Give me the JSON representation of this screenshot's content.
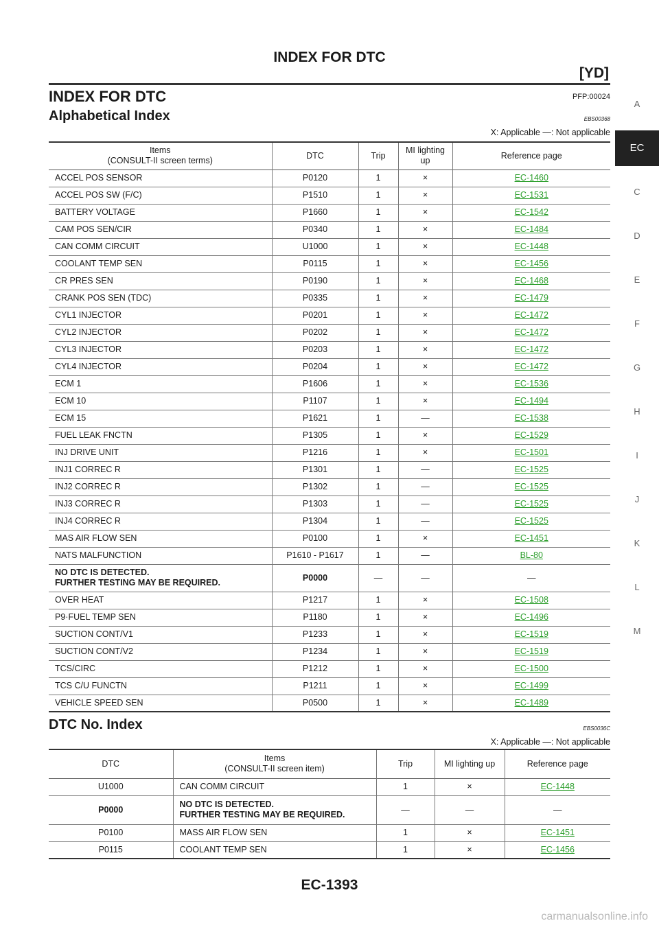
{
  "header": {
    "title": "INDEX FOR DTC",
    "variant": "[YD]"
  },
  "section": {
    "title": "INDEX FOR DTC",
    "code": "PFP:00024"
  },
  "alpha": {
    "title": "Alphabetical Index",
    "code": "EBS00368",
    "legend": "X: Applicable —: Not applicable",
    "columns": {
      "items_1": "Items",
      "items_2": "(CONSULT-II screen terms)",
      "dtc": "DTC",
      "trip": "Trip",
      "mi_1": "MI lighting",
      "mi_2": "up",
      "ref": "Reference page"
    },
    "rows": [
      {
        "item": "ACCEL POS SENSOR",
        "dtc": "P0120",
        "trip": "1",
        "mi": "×",
        "ref": "EC-1460"
      },
      {
        "item": "ACCEL POS SW (F/C)",
        "dtc": "P1510",
        "trip": "1",
        "mi": "×",
        "ref": "EC-1531"
      },
      {
        "item": "BATTERY VOLTAGE",
        "dtc": "P1660",
        "trip": "1",
        "mi": "×",
        "ref": "EC-1542"
      },
      {
        "item": "CAM POS SEN/CIR",
        "dtc": "P0340",
        "trip": "1",
        "mi": "×",
        "ref": "EC-1484"
      },
      {
        "item": "CAN COMM CIRCUIT",
        "dtc": "U1000",
        "trip": "1",
        "mi": "×",
        "ref": "EC-1448"
      },
      {
        "item": "COOLANT TEMP SEN",
        "dtc": "P0115",
        "trip": "1",
        "mi": "×",
        "ref": "EC-1456"
      },
      {
        "item": "CR PRES SEN",
        "dtc": "P0190",
        "trip": "1",
        "mi": "×",
        "ref": "EC-1468"
      },
      {
        "item": "CRANK POS SEN (TDC)",
        "dtc": "P0335",
        "trip": "1",
        "mi": "×",
        "ref": "EC-1479"
      },
      {
        "item": "CYL1 INJECTOR",
        "dtc": "P0201",
        "trip": "1",
        "mi": "×",
        "ref": "EC-1472"
      },
      {
        "item": "CYL2 INJECTOR",
        "dtc": "P0202",
        "trip": "1",
        "mi": "×",
        "ref": "EC-1472"
      },
      {
        "item": "CYL3 INJECTOR",
        "dtc": "P0203",
        "trip": "1",
        "mi": "×",
        "ref": "EC-1472"
      },
      {
        "item": "CYL4 INJECTOR",
        "dtc": "P0204",
        "trip": "1",
        "mi": "×",
        "ref": "EC-1472"
      },
      {
        "item": "ECM 1",
        "dtc": "P1606",
        "trip": "1",
        "mi": "×",
        "ref": "EC-1536"
      },
      {
        "item": "ECM 10",
        "dtc": "P1107",
        "trip": "1",
        "mi": "×",
        "ref": "EC-1494"
      },
      {
        "item": "ECM 15",
        "dtc": "P1621",
        "trip": "1",
        "mi": "—",
        "ref": "EC-1538"
      },
      {
        "item": "FUEL LEAK FNCTN",
        "dtc": "P1305",
        "trip": "1",
        "mi": "×",
        "ref": "EC-1529"
      },
      {
        "item": "INJ DRIVE UNIT",
        "dtc": "P1216",
        "trip": "1",
        "mi": "×",
        "ref": "EC-1501"
      },
      {
        "item": "INJ1 CORREC R",
        "dtc": "P1301",
        "trip": "1",
        "mi": "—",
        "ref": "EC-1525"
      },
      {
        "item": "INJ2 CORREC R",
        "dtc": "P1302",
        "trip": "1",
        "mi": "—",
        "ref": "EC-1525"
      },
      {
        "item": "INJ3 CORREC R",
        "dtc": "P1303",
        "trip": "1",
        "mi": "—",
        "ref": "EC-1525"
      },
      {
        "item": "INJ4 CORREC R",
        "dtc": "P1304",
        "trip": "1",
        "mi": "—",
        "ref": "EC-1525"
      },
      {
        "item": "MAS AIR FLOW SEN",
        "dtc": "P0100",
        "trip": "1",
        "mi": "×",
        "ref": "EC-1451"
      },
      {
        "item": "NATS MALFUNCTION",
        "dtc": "P1610 - P1617",
        "trip": "1",
        "mi": "—",
        "ref": "BL-80"
      },
      {
        "item": "NO DTC IS DETECTED.",
        "item2": "FURTHER TESTING MAY BE REQUIRED.",
        "dtc": "P0000",
        "trip": "—",
        "mi": "—",
        "ref": "—",
        "bold": true
      },
      {
        "item": "OVER HEAT",
        "dtc": "P1217",
        "trip": "1",
        "mi": "×",
        "ref": "EC-1508"
      },
      {
        "item": "P9·FUEL TEMP SEN",
        "dtc": "P1180",
        "trip": "1",
        "mi": "×",
        "ref": "EC-1496"
      },
      {
        "item": "SUCTION CONT/V1",
        "dtc": "P1233",
        "trip": "1",
        "mi": "×",
        "ref": "EC-1519"
      },
      {
        "item": "SUCTION CONT/V2",
        "dtc": "P1234",
        "trip": "1",
        "mi": "×",
        "ref": "EC-1519"
      },
      {
        "item": "TCS/CIRC",
        "dtc": "P1212",
        "trip": "1",
        "mi": "×",
        "ref": "EC-1500"
      },
      {
        "item": "TCS C/U FUNCTN",
        "dtc": "P1211",
        "trip": "1",
        "mi": "×",
        "ref": "EC-1499"
      },
      {
        "item": "VEHICLE SPEED SEN",
        "dtc": "P0500",
        "trip": "1",
        "mi": "×",
        "ref": "EC-1489"
      }
    ]
  },
  "dtcindex": {
    "title": "DTC No. Index",
    "code": "EBS0036C",
    "legend": "X: Applicable —: Not applicable",
    "columns": {
      "dtc": "DTC",
      "items_1": "Items",
      "items_2": "(CONSULT-II screen item)",
      "trip": "Trip",
      "mi": "MI lighting up",
      "ref": "Reference page"
    },
    "rows": [
      {
        "dtc": "U1000",
        "item": "CAN COMM CIRCUIT",
        "trip": "1",
        "mi": "×",
        "ref": "EC-1448"
      },
      {
        "dtc": "P0000",
        "item": "NO DTC IS DETECTED.",
        "item2": "FURTHER TESTING MAY BE REQUIRED.",
        "trip": "—",
        "mi": "—",
        "ref": "—",
        "bold": true
      },
      {
        "dtc": "P0100",
        "item": "MASS AIR FLOW SEN",
        "trip": "1",
        "mi": "×",
        "ref": "EC-1451"
      },
      {
        "dtc": "P0115",
        "item": "COOLANT TEMP SEN",
        "trip": "1",
        "mi": "×",
        "ref": "EC-1456"
      }
    ]
  },
  "tabs": [
    "A",
    "EC",
    "C",
    "D",
    "E",
    "F",
    "G",
    "H",
    "I",
    "J",
    "K",
    "L",
    "M"
  ],
  "active_tab": "EC",
  "footer": {
    "page": "EC-1393"
  },
  "watermark": "carmanualsonline.info",
  "colors": {
    "link": "#2a9d2a",
    "tab_active_bg": "#222222"
  }
}
